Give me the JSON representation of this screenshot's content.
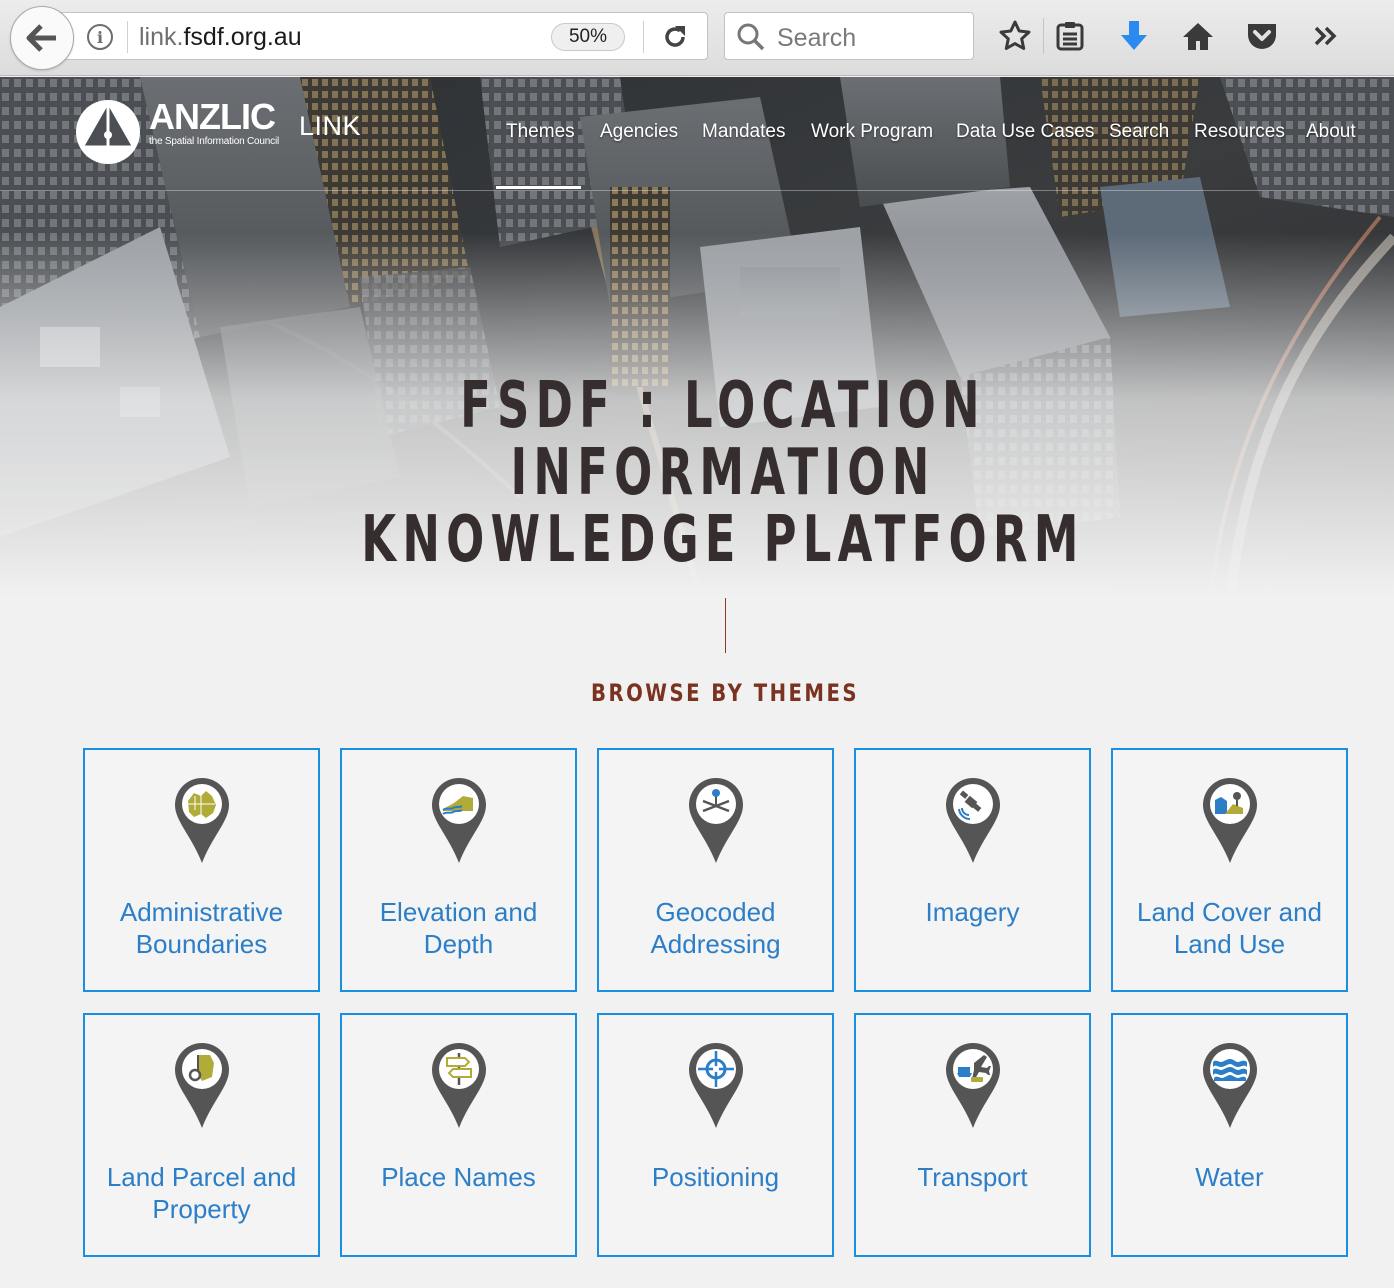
{
  "browser": {
    "url_prefix": "link.",
    "url_domain": "fsdf.org.au",
    "zoom": "50%",
    "search_placeholder": "Search"
  },
  "site": {
    "logo_name": "ANZLIC",
    "logo_tagline": "the Spatial Information Council",
    "logo_suffix": "LINK",
    "active_nav": "Themes",
    "nav": [
      "Themes",
      "Agencies",
      "Mandates",
      "Work Program",
      "Data Use Cases",
      "Search",
      "Resources",
      "About"
    ]
  },
  "hero": {
    "title_line1": "FSDF : LOCATION",
    "title_line2": "INFORMATION",
    "title_line3": "KNOWLEDGE PLATFORM"
  },
  "themes": {
    "heading": "BROWSE BY THEMES",
    "items": [
      {
        "label_line1": "Administrative",
        "label_line2": "Boundaries",
        "icon": "australia-map-icon"
      },
      {
        "label_line1": "Elevation and",
        "label_line2": "Depth",
        "icon": "terrain-icon"
      },
      {
        "label_line1": "Geocoded",
        "label_line2": "Addressing",
        "icon": "location-marker-icon"
      },
      {
        "label_line1": "Imagery",
        "label_line2": "",
        "icon": "satellite-icon"
      },
      {
        "label_line1": "Land Cover and",
        "label_line2": "Land Use",
        "icon": "land-cover-icon"
      },
      {
        "label_line1": "Land Parcel and",
        "label_line2": "Property",
        "icon": "parcel-icon"
      },
      {
        "label_line1": "Place Names",
        "label_line2": "",
        "icon": "signpost-icon"
      },
      {
        "label_line1": "Positioning",
        "label_line2": "",
        "icon": "crosshair-icon"
      },
      {
        "label_line1": "Transport",
        "label_line2": "",
        "icon": "transport-icon"
      },
      {
        "label_line1": "Water",
        "label_line2": "",
        "icon": "waves-icon"
      }
    ]
  }
}
